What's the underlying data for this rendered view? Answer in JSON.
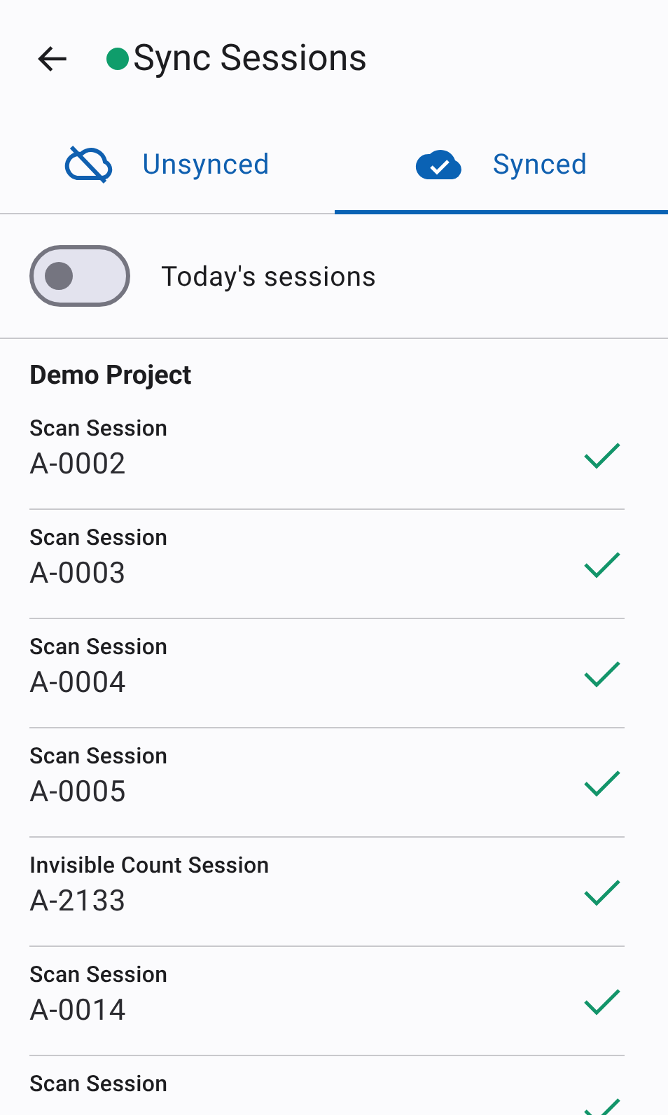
{
  "header": {
    "title": "Sync Sessions"
  },
  "tabs": [
    {
      "label": "Unsynced",
      "kind": "unsynced",
      "selected": false
    },
    {
      "label": "Synced",
      "kind": "synced",
      "selected": true
    }
  ],
  "filter": {
    "label": "Today's sessions",
    "on": false
  },
  "group": {
    "title": "Demo Project"
  },
  "sessions": [
    {
      "type": "Scan Session",
      "code": "A-0002",
      "synced": true
    },
    {
      "type": "Scan Session",
      "code": "A-0003",
      "synced": true
    },
    {
      "type": "Scan Session",
      "code": "A-0004",
      "synced": true
    },
    {
      "type": "Scan Session",
      "code": "A-0005",
      "synced": true
    },
    {
      "type": "Invisible Count Session",
      "code": "A-2133",
      "synced": true
    },
    {
      "type": "Scan Session",
      "code": "A-0014",
      "synced": true
    },
    {
      "type": "Scan Session",
      "synced": true
    }
  ]
}
